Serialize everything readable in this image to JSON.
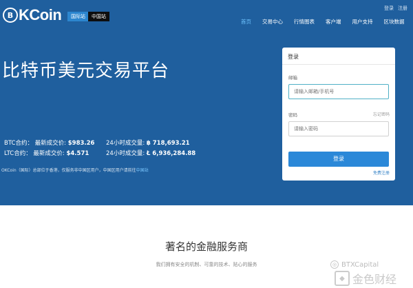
{
  "header": {
    "logo_mark": "B",
    "logo_text": "KCoin",
    "region_intl": "国际站",
    "region_cn": "中国站",
    "top_links": [
      "登录",
      "注册"
    ],
    "nav": [
      {
        "label": "首页",
        "active": true
      },
      {
        "label": "交易中心",
        "active": false
      },
      {
        "label": "行情图表",
        "active": false
      },
      {
        "label": "客户端",
        "active": false
      },
      {
        "label": "用户支持",
        "active": false
      },
      {
        "label": "区块数据",
        "active": false
      }
    ]
  },
  "hero": {
    "headline": "比特币美元交易平台",
    "btc": {
      "prefix": "BTC合约：  最新成交价:",
      "price": "$983.26",
      "vol_label": "24小时成交量:",
      "vol": "฿ 718,693.21"
    },
    "ltc": {
      "prefix": "LTC合约：  最新成交价:",
      "price": "$4.571",
      "vol_label": "24小时成交量:",
      "vol": "Ł 6,936,284.88"
    },
    "notice": "OKCoin（国际）总部位于香港，仅服务非中国区用户，中国区用户请前往",
    "notice_link": "中国站"
  },
  "login": {
    "title": "登录",
    "email_label": "邮箱",
    "email_placeholder": "请输入邮箱/手机号",
    "password_label": "密码",
    "forgot": "忘记密码",
    "password_placeholder": "请输入密码",
    "submit": "登录",
    "register": "免费注册"
  },
  "section": {
    "title": "著名的金融服务商",
    "subtitle": "我们拥有安全的机制、可靠的技术、贴心的服务"
  },
  "watermark": {
    "top": "BTXCapital",
    "bottom": "金色财经"
  },
  "colors": {
    "hero_bg": "#1f5f9e",
    "accent": "#2b88d8",
    "nav_active": "#6ec3ff"
  }
}
